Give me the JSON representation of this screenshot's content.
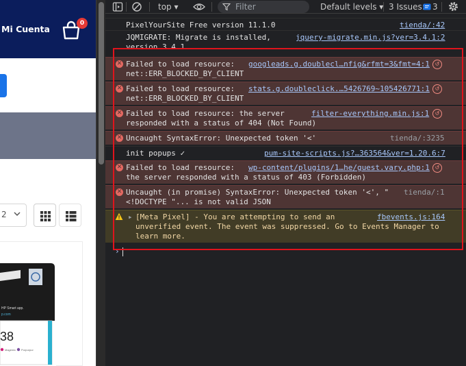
{
  "website": {
    "account_label": "Mi Cuenta",
    "cart_count": "0",
    "per_page_value": "2",
    "product_card": {
      "box_text_1": "HP Smart app.",
      "box_text_2": "p.com",
      "box_number": "38",
      "box_color_1": "Magenta",
      "box_color_2": "Purpurpur"
    }
  },
  "devtools": {
    "toolbar": {
      "context": "top ▾",
      "filter_placeholder": "Filter",
      "levels": "Default levels ▾",
      "issues_label": "3 Issues:",
      "issues_count": "3"
    },
    "messages": [
      {
        "type": "info",
        "text": "PixelYourSite Free version 11.1.0",
        "source": "tienda/:42"
      },
      {
        "type": "info",
        "text": "JQMIGRATE: Migrate is installed,\nversion 3.4.1",
        "source": "jquery-migrate.min.js?ver=3.4.1:2"
      },
      {
        "type": "error",
        "text": "Failed to load resource:\nnet::ERR_BLOCKED_BY_CLIENT",
        "source": "googleads.g.doublecl…nfig&rfmt=3&fmt=4:1"
      },
      {
        "type": "error",
        "text": "Failed to load resource:\nnet::ERR_BLOCKED_BY_CLIENT",
        "source": "stats.g.doubleclick.…5426769~105426771:1"
      },
      {
        "type": "error",
        "text": "Failed to load resource: the server\nresponded with a status of 404 (Not Found)",
        "source": "filter-everything.min.js:1"
      },
      {
        "type": "error",
        "text": "Uncaught SyntaxError: Unexpected token '<'",
        "source": "tienda/:3235"
      },
      {
        "type": "info",
        "text": "init popups ✓",
        "source": "pum-site-scripts.js?…363564&ver=1.20.6:7"
      },
      {
        "type": "error",
        "text": "Failed to load resource:\nthe server responded with a status of 403 (Forbidden)",
        "source": "wp-content/plugins/1…he/guest.vary.php:1"
      },
      {
        "type": "error",
        "text": "Uncaught (in promise) SyntaxError: Unexpected token '<', \"\n<!DOCTYPE \"... is not valid JSON",
        "source": "tienda/:1"
      },
      {
        "type": "warning",
        "text": "[Meta Pixel] - You are attempting to send an\nunverified event. The event was suppressed. Go to Events Manager to\nlearn more.",
        "source": "fbevents.js:164"
      }
    ],
    "prompt_symbol": "›"
  },
  "colors": {
    "site_header": "#0b1d5c",
    "highlight": "#e0141c",
    "error_bg": "#4e3534",
    "warning_bg": "#413c26",
    "link": "#a8c7fa"
  }
}
